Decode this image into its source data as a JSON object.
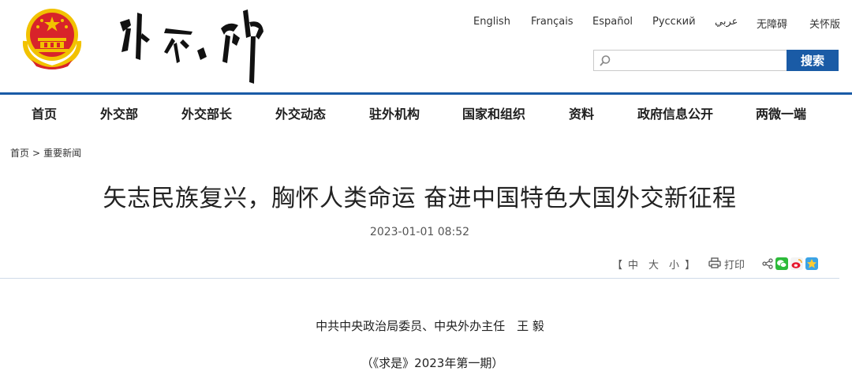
{
  "header": {
    "emblem_icon": "national-emblem-icon",
    "logo_text": "外交部",
    "languages": [
      "English",
      "Français",
      "Español",
      "Русский",
      "عربي",
      "无障碍",
      "关怀版"
    ]
  },
  "search": {
    "placeholder": "",
    "button_label": "搜索"
  },
  "nav": {
    "items": [
      "首页",
      "外交部",
      "外交部长",
      "外交动态",
      "驻外机构",
      "国家和组织",
      "资料",
      "政府信息公开",
      "两微一端"
    ]
  },
  "breadcrumb": {
    "home": "首页",
    "separator": ">",
    "section": "重要新闻"
  },
  "article": {
    "title": "矢志民族复兴，胸怀人类命运 奋进中国特色大国外交新征程",
    "date": "2023-01-01 08:52",
    "author": "中共中央政治局委员、中央外办主任　王 毅",
    "source": "（《求是》2023年第一期）"
  },
  "tools": {
    "bracket_left": "【",
    "size_large": "中",
    "size_medium": "大",
    "size_small": "小",
    "bracket_right": "】",
    "print_label": "打印"
  },
  "colors": {
    "brand_blue": "#1a5ba6",
    "emblem_red": "#d8232a",
    "emblem_gold": "#f2c200"
  }
}
